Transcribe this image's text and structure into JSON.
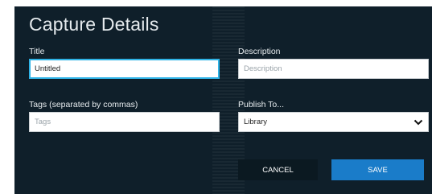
{
  "dialog": {
    "title": "Capture Details",
    "title_field": {
      "label": "Title",
      "value": "Untitled"
    },
    "description_field": {
      "label": "Description",
      "placeholder": "Description"
    },
    "tags_field": {
      "label": "Tags (separated by commas)",
      "placeholder": "Tags"
    },
    "publish_field": {
      "label": "Publish To...",
      "selected": "Library"
    },
    "buttons": {
      "cancel": "CANCEL",
      "save": "SAVE"
    }
  },
  "colors": {
    "dialog_bg": "#0f1f2a",
    "focus_border": "#2fb3e6",
    "save_bg": "#1a7cc9",
    "cancel_bg": "#0b1921"
  }
}
